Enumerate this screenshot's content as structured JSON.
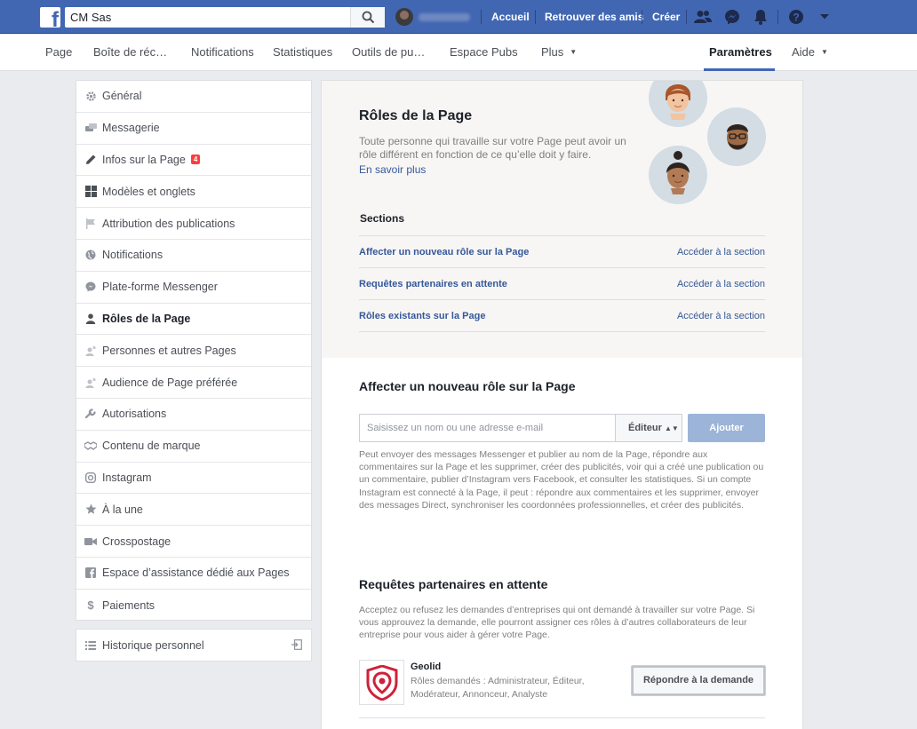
{
  "topbar": {
    "search_value": "CM Sas",
    "nav": [
      "Accueil",
      "Retrouver des amis",
      "Créer"
    ],
    "icons": [
      "friends-icon",
      "messenger-icon",
      "notifications-bell-icon",
      "help-icon",
      "menu-caret-icon"
    ],
    "accent": "#4267b2"
  },
  "pagebar": {
    "tabs": [
      "Page",
      "Boîte de réc…",
      "Notifications",
      "Statistiques",
      "Outils de pu…",
      "Espace Pubs",
      "Plus",
      "Paramètres",
      "Aide"
    ],
    "active_tab": "Paramètres"
  },
  "sidebar": {
    "items": [
      {
        "label": "Général",
        "icon": "gear-icon"
      },
      {
        "label": "Messagerie",
        "icon": "chat-bubbles-icon"
      },
      {
        "label": "Infos sur la Page",
        "icon": "pencil-icon",
        "badge": "4"
      },
      {
        "label": "Modèles et onglets",
        "icon": "grid-icon"
      },
      {
        "label": "Attribution des publications",
        "icon": "flag-icon"
      },
      {
        "label": "Notifications",
        "icon": "globe-icon"
      },
      {
        "label": "Plate-forme Messenger",
        "icon": "messenger-icon"
      },
      {
        "label": "Rôles de la Page",
        "icon": "person-icon",
        "active": true
      },
      {
        "label": "Personnes et autres Pages",
        "icon": "person-star-icon"
      },
      {
        "label": "Audience de Page préférée",
        "icon": "person-star-icon"
      },
      {
        "label": "Autorisations",
        "icon": "wrench-icon"
      },
      {
        "label": "Contenu de marque",
        "icon": "handshake-icon"
      },
      {
        "label": "Instagram",
        "icon": "instagram-icon"
      },
      {
        "label": "À la une",
        "icon": "star-icon"
      },
      {
        "label": "Crosspostage",
        "icon": "video-camera-icon"
      },
      {
        "label": "Espace d’assistance dédié aux Pages",
        "icon": "facebook-square-icon"
      },
      {
        "label": "Paiements",
        "icon": "dollar-icon"
      }
    ],
    "history_label": "Historique personnel"
  },
  "hero": {
    "title": "Rôles de la Page",
    "description": "Toute personne qui travaille sur votre Page peut avoir un rôle différent en fonction de ce qu’elle doit y faire.",
    "learn_more": "En savoir plus",
    "sections_title": "Sections",
    "sections": [
      {
        "name": "Affecter un nouveau rôle sur la Page",
        "link": "Accéder à la section"
      },
      {
        "name": "Requêtes partenaires en attente",
        "link": "Accéder à la section"
      },
      {
        "name": "Rôles existants sur la Page",
        "link": "Accéder à la section"
      }
    ]
  },
  "assign": {
    "title": "Affecter un nouveau rôle sur la Page",
    "placeholder": "Saisissez un nom ou une adresse e-mail",
    "role": "Éditeur",
    "add_label": "Ajouter",
    "description": "Peut envoyer des messages Messenger et publier au nom de la Page, répondre aux commentaires sur la Page et les supprimer, créer des publicités, voir qui a créé une publication ou un commentaire, publier d’Instagram vers Facebook, et consulter les statistiques. Si un compte Instagram est connecté à la Page, il peut : répondre aux commentaires et les supprimer, envoyer des messages Direct, synchroniser les coordonnées professionnelles, et créer des publicités."
  },
  "partners": {
    "title": "Requêtes partenaires en attente",
    "description": "Acceptez ou refusez les demandes d’entreprises qui ont demandé à travailler sur votre Page. Si vous approuvez la demande, elle pourront assigner ces rôles à d’autres collaborateurs de leur entreprise pour vous aider à gérer votre Page.",
    "request": {
      "name": "Geolid",
      "roles": "Rôles demandés : Administrateur, Éditeur, Modérateur, Annonceur, Analyste",
      "button": "Répondre à la demande"
    }
  }
}
